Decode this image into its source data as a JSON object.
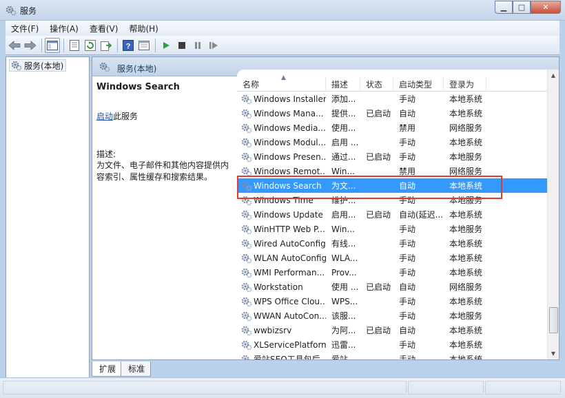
{
  "window": {
    "title": "服务",
    "controls": {
      "minimize": "▁",
      "maximize": "□",
      "close": "✕"
    }
  },
  "menubar": [
    "文件(F)",
    "操作(A)",
    "查看(V)",
    "帮助(H)"
  ],
  "toolbar": [
    "back-arrow-icon",
    "forward-arrow-icon",
    "show-hide-tree-icon",
    "properties-icon",
    "refresh-icon",
    "export-list-icon",
    "help-icon",
    "console-tree-icon",
    "start-service-icon",
    "stop-service-icon",
    "pause-service-icon",
    "resume-service-icon"
  ],
  "tree": {
    "label": "服务(本地)"
  },
  "content_header": {
    "title": "服务(本地)"
  },
  "description_pane": {
    "service_name": "Windows Search",
    "start_link": "启动",
    "start_suffix": "此服务",
    "desc_label": "描述:",
    "desc_text": "为文件、电子邮件和其他内容提供内\n容索引、属性缓存和搜索结果。"
  },
  "columns": [
    "名称",
    "描述",
    "状态",
    "启动类型",
    "登录为"
  ],
  "services": [
    {
      "name": "Windows Installer",
      "desc": "添加...",
      "status": "",
      "startup": "手动",
      "logon": "本地系统"
    },
    {
      "name": "Windows Mana...",
      "desc": "提供...",
      "status": "已启动",
      "startup": "自动",
      "logon": "本地系统"
    },
    {
      "name": "Windows Media...",
      "desc": "使用...",
      "status": "",
      "startup": "禁用",
      "logon": "网络服务"
    },
    {
      "name": "Windows Modul...",
      "desc": "启用 ...",
      "status": "",
      "startup": "手动",
      "logon": "本地系统"
    },
    {
      "name": "Windows Presen...",
      "desc": "通过...",
      "status": "已启动",
      "startup": "手动",
      "logon": "本地服务"
    },
    {
      "name": "Windows Remot...",
      "desc": "Win...",
      "status": "",
      "startup": "禁用",
      "logon": "网络服务"
    },
    {
      "name": "Windows Search",
      "desc": "为文...",
      "status": "",
      "startup": "自动",
      "logon": "本地系统",
      "selected": true
    },
    {
      "name": "Windows Time",
      "desc": "维护...",
      "status": "",
      "startup": "手动",
      "logon": "本地服务"
    },
    {
      "name": "Windows Update",
      "desc": "启用...",
      "status": "已启动",
      "startup": "自动(延迟...",
      "logon": "本地系统"
    },
    {
      "name": "WinHTTP Web P...",
      "desc": "Win...",
      "status": "",
      "startup": "手动",
      "logon": "本地服务"
    },
    {
      "name": "Wired AutoConfig",
      "desc": "有线...",
      "status": "",
      "startup": "手动",
      "logon": "本地系统"
    },
    {
      "name": "WLAN AutoConfig",
      "desc": "WLA...",
      "status": "",
      "startup": "手动",
      "logon": "本地系统"
    },
    {
      "name": "WMI Performan...",
      "desc": "Prov...",
      "status": "",
      "startup": "手动",
      "logon": "本地系统"
    },
    {
      "name": "Workstation",
      "desc": "使用 ...",
      "status": "已启动",
      "startup": "自动",
      "logon": "网络服务"
    },
    {
      "name": "WPS Office Clou...",
      "desc": "WPS...",
      "status": "",
      "startup": "手动",
      "logon": "本地系统"
    },
    {
      "name": "WWAN AutoCon...",
      "desc": "该服...",
      "status": "",
      "startup": "手动",
      "logon": "本地服务"
    },
    {
      "name": "wwbizsrv",
      "desc": "为阿...",
      "status": "已启动",
      "startup": "自动",
      "logon": "本地系统"
    },
    {
      "name": "XLServicePlatform",
      "desc": "迅雷...",
      "status": "",
      "startup": "手动",
      "logon": "本地系统"
    },
    {
      "name": "爱站SEO工具包后...",
      "desc": "爱站...",
      "status": "",
      "startup": "手动",
      "logon": "本地系统"
    }
  ],
  "tabs": [
    "扩展",
    "标准"
  ],
  "colors": {
    "selection": "#3399ff",
    "highlight_box": "#e03a35",
    "link": "#1a4ea1"
  }
}
